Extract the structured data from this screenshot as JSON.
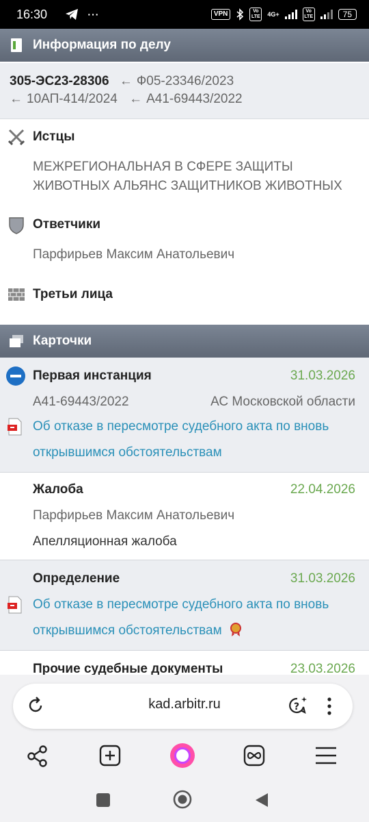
{
  "status_bar": {
    "time": "16:30",
    "dots": "···",
    "vpn": "VPN",
    "vo1": "Vo LTE",
    "net": "4G+",
    "vo2": "Vo LTE",
    "battery": "75"
  },
  "case_info": {
    "header": "Информация по делу",
    "main_number": "305-ЭС23-28306",
    "related": [
      "Ф05-23346/2023",
      "10АП-414/2024",
      "А41-69443/2022"
    ],
    "arrow": "←"
  },
  "plaintiffs": {
    "label": "Истцы",
    "text": "МЕЖРЕГИОНАЛЬНАЯ В СФЕРЕ ЗАЩИТЫ ЖИВОТНЫХ АЛЬЯНС ЗАЩИТНИКОВ ЖИВОТНЫХ"
  },
  "defendants": {
    "label": "Ответчики",
    "text": "Парфирьев Максим Анатольевич"
  },
  "third_parties": {
    "label": "Третьи лица"
  },
  "cards": {
    "header": "Карточки",
    "first": {
      "title": "Первая инстанция",
      "date": "31.03.2026",
      "case": "А41-69443/2022",
      "court": "АС Московской области",
      "link_line1": "Об отказе в пересмотре судебного акта по вновь",
      "link_line2": "открывшимся обстоятельствам"
    },
    "complaint": {
      "title": "Жалоба",
      "date": "22.04.2026",
      "author": "Парфирьев Максим Анатольевич",
      "type": "Апелляционная жалоба"
    },
    "ruling": {
      "title": "Определение",
      "date": "31.03.2026",
      "link_line1": "Об отказе в пересмотре судебного акта по вновь",
      "link_line2": "открывшимся обстоятельствам"
    },
    "other": {
      "title": "Прочие судебные документы",
      "date": "23.03.2026"
    }
  },
  "browser": {
    "url": "kad.arbitr.ru"
  }
}
